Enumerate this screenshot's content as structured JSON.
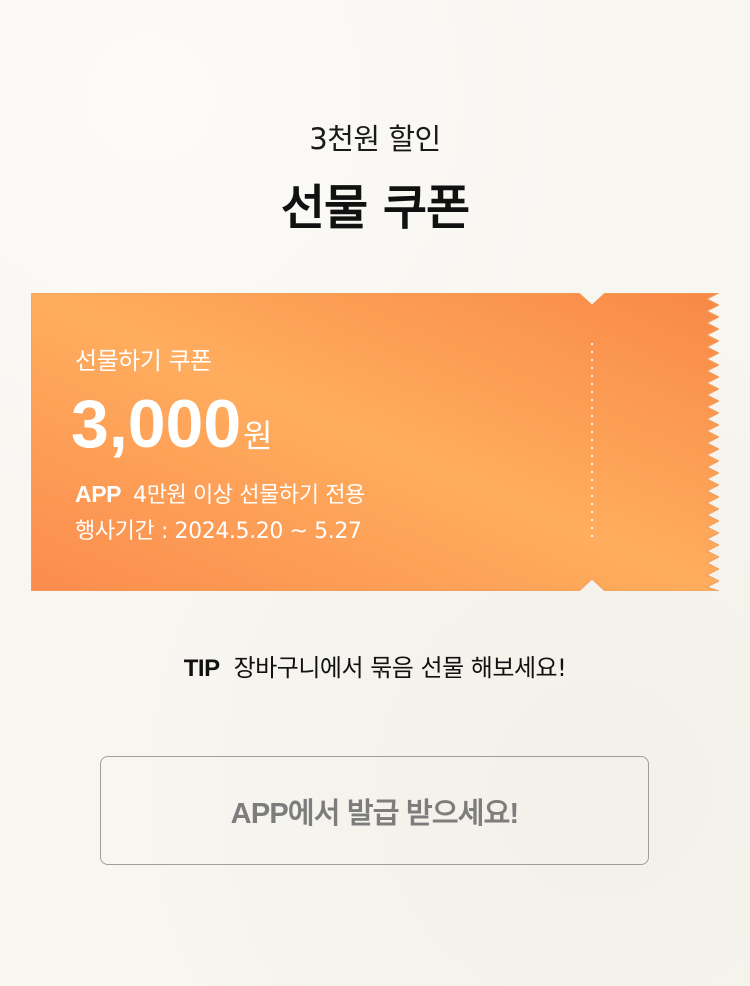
{
  "header": {
    "subtitle": "3천원 할인",
    "title": "선물 쿠폰"
  },
  "coupon": {
    "label": "선물하기 쿠폰",
    "amount": "3,000",
    "unit": "원",
    "platform": "APP",
    "condition": "4만원 이상 선물하기 전용",
    "period": "행사기간 : 2024.5.20 ~ 5.27",
    "colors": {
      "gradient_start": "#fb8c4d",
      "gradient_mid": "#ffad5e",
      "gradient_end": "#f88847"
    }
  },
  "tip": {
    "label": "TIP",
    "text": "장바구니에서 묶음 선물 해보세요!"
  },
  "cta": {
    "label": "APP에서 발급 받으세요!"
  },
  "colors": {
    "background": "#f8f6f1",
    "button_border": "#9e9e9e",
    "button_text": "#7d7d7d"
  }
}
